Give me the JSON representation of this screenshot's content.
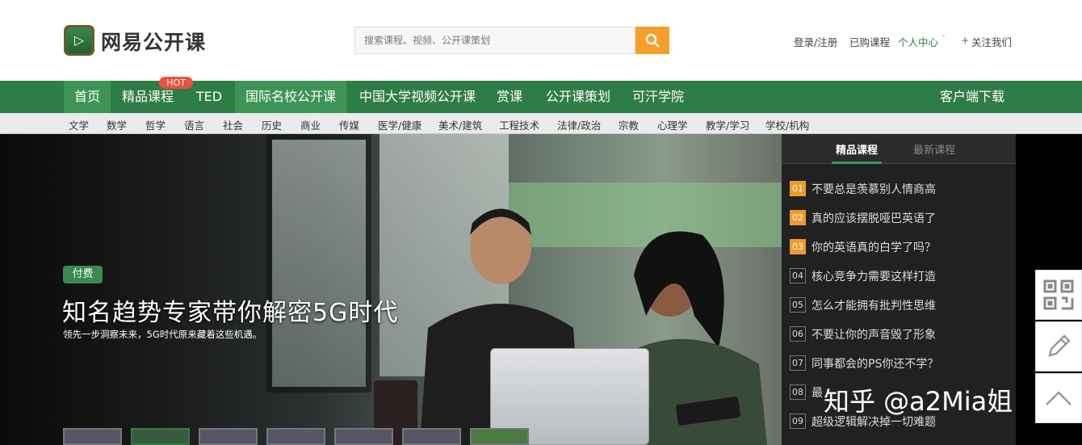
{
  "header": {
    "logo_text": "网易公开课",
    "search_placeholder": "搜索课程、视频、公开课策划",
    "links": {
      "login": "登录/注册",
      "purchased": "已购课程",
      "personal": "个人中心",
      "follow": "关注我们"
    }
  },
  "nav": {
    "items": [
      "首页",
      "精品课程",
      "TED",
      "国际名校公开课",
      "中国大学视频公开课",
      "赏课",
      "公开课策划",
      "可汗学院"
    ],
    "hot_badge": "HOT",
    "download": "客户端下载"
  },
  "subnav": [
    "文学",
    "数学",
    "哲学",
    "语言",
    "社会",
    "历史",
    "商业",
    "传媒",
    "医学/健康",
    "美术/建筑",
    "工程技术",
    "法律/政治",
    "宗教",
    "心理学",
    "教学/学习",
    "学校/机构"
  ],
  "banner": {
    "badge": "付费",
    "title": "知名趋势专家带你解密5G时代",
    "subtitle": "领先一步洞察未来，5G时代原来藏着这些机遇。"
  },
  "panel": {
    "tabs": [
      "精品课程",
      "最新课程"
    ],
    "items": [
      {
        "num": "01",
        "text": "不要总是羡慕别人情商高"
      },
      {
        "num": "02",
        "text": "真的应该摆脱哑巴英语了"
      },
      {
        "num": "03",
        "text": "你的英语真的白学了吗？"
      },
      {
        "num": "04",
        "text": "核心竞争力需要这样打造"
      },
      {
        "num": "05",
        "text": "怎么才能拥有批判性思维"
      },
      {
        "num": "06",
        "text": "不要让你的声音毁了形象"
      },
      {
        "num": "07",
        "text": "同事都会的PS你还不学？"
      },
      {
        "num": "08",
        "text": "最"
      },
      {
        "num": "09",
        "text": "超级逻辑解决掉一切难题"
      }
    ]
  },
  "watermark": "知乎 @a2Mia姐",
  "colors": {
    "nav_green": "#2f7d46",
    "search_orange": "#f5a02c",
    "hot_red": "#e8523f",
    "rank_orange": "#f09a2a"
  }
}
